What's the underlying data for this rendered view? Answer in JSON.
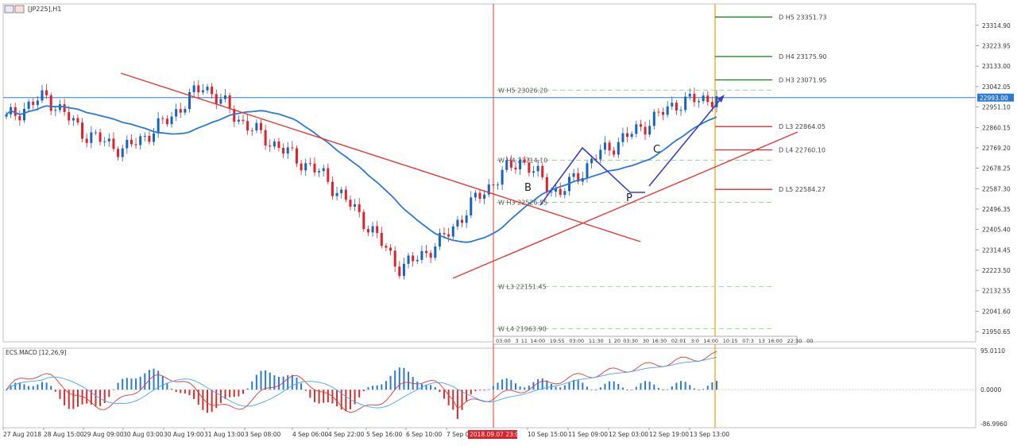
{
  "main_chart": {
    "symbol_label": "[JP225],H1",
    "current_price_tag": "22993.00"
  },
  "macd_panel": {
    "label": "ECS.MACD [12,26,9]",
    "top_value": "95.0110",
    "zero_value": "0.0000",
    "bottom_value": "-86.9960"
  },
  "colors": {
    "bull_candle": "#1565c0",
    "bear_candle": "#e0202a",
    "moving_average": "#2a7ad5",
    "trendline_red": "#e53935",
    "pattern_blue": "#3a3fc8",
    "daily_pivot_green": "#1b7a1b",
    "daily_pivot_red": "#d32f2f",
    "weekly_pivot_dashed": "#9ad69a",
    "vertical_orange": "#f5a000",
    "vertical_red": "#e04020",
    "macd_histogram": "#2a7ad5",
    "macd_histogram_negative": "#d32f2f",
    "macd_line": "#e53935",
    "macd_signal": "#42a5f5"
  },
  "chart_data": {
    "type": "candlestick",
    "price_axis_ticks": [
      "23314.90",
      "23223.95",
      "23133.00",
      "23042.05",
      "22951.10",
      "22860.15",
      "22769.20",
      "22678.25",
      "22587.30",
      "22496.35",
      "22405.40",
      "22314.45",
      "22223.50",
      "22132.55",
      "22041.60",
      "21950.65"
    ],
    "price_range": [
      21905,
      23410
    ],
    "time_axis_labels": [
      "27 Aug 2018",
      "28 Aug 15:00",
      "29 Aug 09:00",
      "30 Aug 03:00",
      "30 Aug 19:00",
      "31 Aug 13:00",
      "3 Sep 08:00",
      "4 Sep 06:00",
      "4 Sep 22:00",
      "5 Sep 16:00",
      "6 Sep 10:00",
      "7 Sep 0",
      "10 Sep 15:00",
      "11 Sep 09:00",
      "12 Sep 03:00",
      "12 Sep 19:00",
      "13 Sep 13:00"
    ],
    "time_highlight_label": "2018.09.07 23:00",
    "mini_time_labels": [
      "03:00",
      "3",
      "11",
      "14:00",
      "19:55",
      "03:00",
      "11:30",
      "1",
      "20",
      "03:30",
      "30",
      "16:30",
      "02:01",
      "3:0",
      "14:00",
      "10:15",
      "07:3",
      "13",
      "16:00",
      "22:30",
      "00"
    ],
    "pivot_levels": [
      {
        "label": "D  H5 23351.73",
        "value": 23351.73,
        "type": "daily_resistance"
      },
      {
        "label": "D  H4 23175.90",
        "value": 23175.9,
        "type": "daily_resistance"
      },
      {
        "label": "D  H3 23071.95",
        "value": 23071.95,
        "type": "daily_resistance"
      },
      {
        "label": "D  L3 22864.05",
        "value": 22864.05,
        "type": "daily_support"
      },
      {
        "label": "D  L4 22760.10",
        "value": 22760.1,
        "type": "daily_support"
      },
      {
        "label": "D  L5 22584.27",
        "value": 22584.27,
        "type": "daily_support"
      },
      {
        "label": "W  H5 23026.20",
        "value": 23026.2,
        "type": "weekly"
      },
      {
        "label": "W  H4 22714.10",
        "value": 22714.1,
        "type": "weekly"
      },
      {
        "label": "W  H3 22526.55",
        "value": 22526.55,
        "type": "weekly"
      },
      {
        "label": "W  L3 22151.45",
        "value": 22151.45,
        "type": "weekly"
      },
      {
        "label": "W  L4 21963.90",
        "value": 21963.9,
        "type": "weekly"
      }
    ],
    "current_price": 22993.0,
    "pattern_labels": [
      "B",
      "P",
      "C"
    ],
    "macd_range": [
      -86.996,
      95.011
    ],
    "candle_path_key_prices": [
      22900,
      23000,
      22830,
      22760,
      22880,
      23050,
      22880,
      22760,
      22650,
      22460,
      22230,
      22350,
      22560,
      22720,
      22560,
      22740,
      22850,
      22970,
      22993
    ],
    "candle_count": 160
  }
}
